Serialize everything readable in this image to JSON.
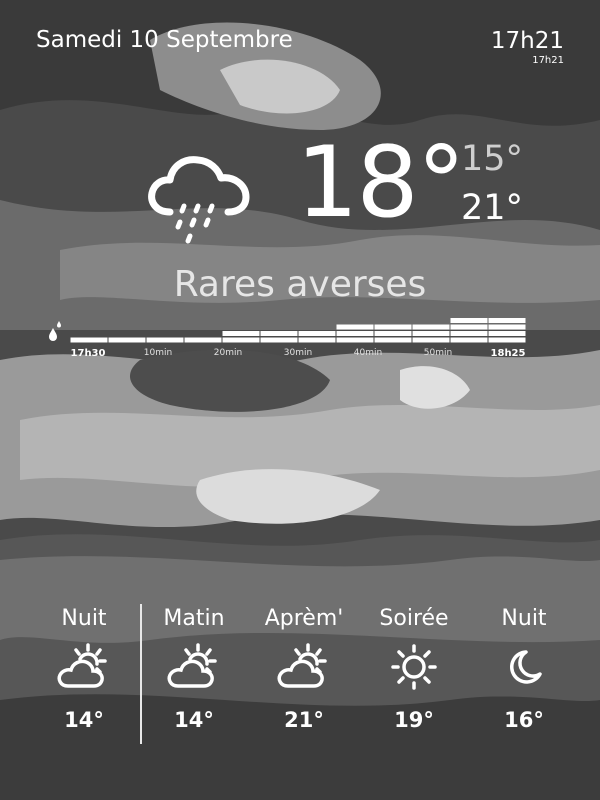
{
  "header": {
    "date": "Samedi 10 Septembre",
    "time": "17h21",
    "updated": "17h21"
  },
  "current": {
    "icon": "cloud-rain-icon",
    "temperature": "18°",
    "min": "15°",
    "max": "21°",
    "condition": "Rares averses"
  },
  "rain_forecast": {
    "icon": "raindrops-icon",
    "start_label": "17h30",
    "end_label": "18h25",
    "ticks": [
      "10min",
      "20min",
      "30min",
      "40min",
      "50min"
    ],
    "intensity": [
      1,
      1,
      1,
      1,
      2,
      2,
      2,
      3,
      3,
      3,
      4,
      4
    ]
  },
  "forecast": [
    {
      "label": "Nuit",
      "icon": "partly-cloudy-icon",
      "temp": "14°"
    },
    {
      "label": "Matin",
      "icon": "partly-cloudy-icon",
      "temp": "14°"
    },
    {
      "label": "Aprèm'",
      "icon": "partly-cloudy-icon",
      "temp": "21°"
    },
    {
      "label": "Soirée",
      "icon": "sun-icon",
      "temp": "19°"
    },
    {
      "label": "Nuit",
      "icon": "moon-icon",
      "temp": "16°"
    }
  ]
}
